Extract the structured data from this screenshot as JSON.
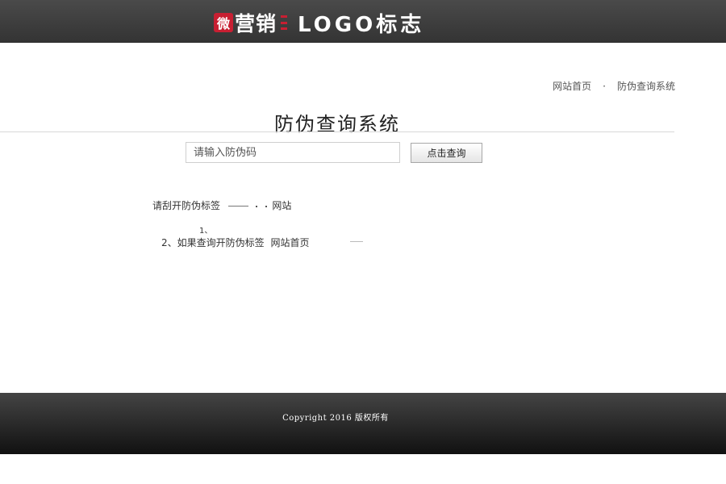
{
  "header": {
    "logo": {
      "badge": "微",
      "prefix": "营销",
      "text": "LOGO标志"
    }
  },
  "breadcrumb": {
    "home": "网站首页",
    "separator": "·",
    "current": "防伪查询系统"
  },
  "page": {
    "title": "防伪查询系统"
  },
  "search": {
    "placeholder": "请输入防伪码",
    "value": "",
    "button_label": "点击查询"
  },
  "instructions": {
    "line1_prefix": "请刮开防伪标签",
    "line1_suffix": "网站",
    "line2": "1、",
    "line3_prefix": "2、如果查询开防伪标签",
    "line3_link": "网站首页"
  },
  "footer": {
    "copyright": "Copyright 2016 版权所有"
  },
  "colors": {
    "header_bg": "#3b3b3b",
    "logo_red": "#c81f32",
    "footer_bg": "#1b1b1b",
    "button_bg": "#eeeeee"
  }
}
